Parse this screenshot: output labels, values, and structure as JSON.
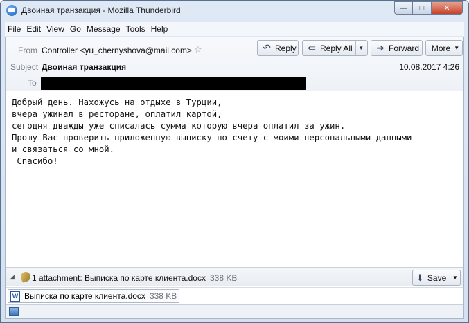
{
  "window": {
    "title": "Двоиная транзакция - Mozilla Thunderbird",
    "minimize_glyph": "—",
    "maximize_glyph": "□",
    "close_glyph": "✕"
  },
  "menu": [
    "File",
    "Edit",
    "View",
    "Go",
    "Message",
    "Tools",
    "Help"
  ],
  "header": {
    "from_label": "From",
    "from_value": "Controller <yu_chernyshova@mail.com>",
    "subject_label": "Subject",
    "subject_value": "Двоиная транзакция",
    "to_label": "To",
    "date": "10.08.2017 4:26",
    "buttons": {
      "reply": "Reply",
      "reply_all": "Reply All",
      "forward": "Forward",
      "more": "More"
    }
  },
  "body": {
    "lines": [
      "Добрый день. Нахожусь на отдыхе в Турции,",
      "вчера ужинал в ресторане, оплатил картой,",
      "сегодня дважды уже списалась сумма которую вчера оплатил за ужин.",
      "Прошу Вас проверить приложенную выписку по счету с моими персональными данными",
      "и связаться со мной.",
      " Спасибо!"
    ]
  },
  "attachments": {
    "summary": "1 attachment: Выписка по карте клиента.docx",
    "total_size": "338 KB",
    "save_label": "Save",
    "items": [
      {
        "name": "Выписка по карте клиента.docx",
        "size": "338 KB"
      }
    ]
  },
  "icons": {
    "reply": "reply-arrow-icon",
    "reply_all": "reply-all-arrow-icon",
    "forward": "forward-arrow-icon",
    "save": "download-arrow-icon",
    "star": "star-outline-icon",
    "attachment": "paperclip-icon",
    "document": "word-document-icon"
  },
  "colors": {
    "title_bar": "#d3e1f1",
    "close_button": "#c7432c",
    "redaction": "#000000"
  }
}
